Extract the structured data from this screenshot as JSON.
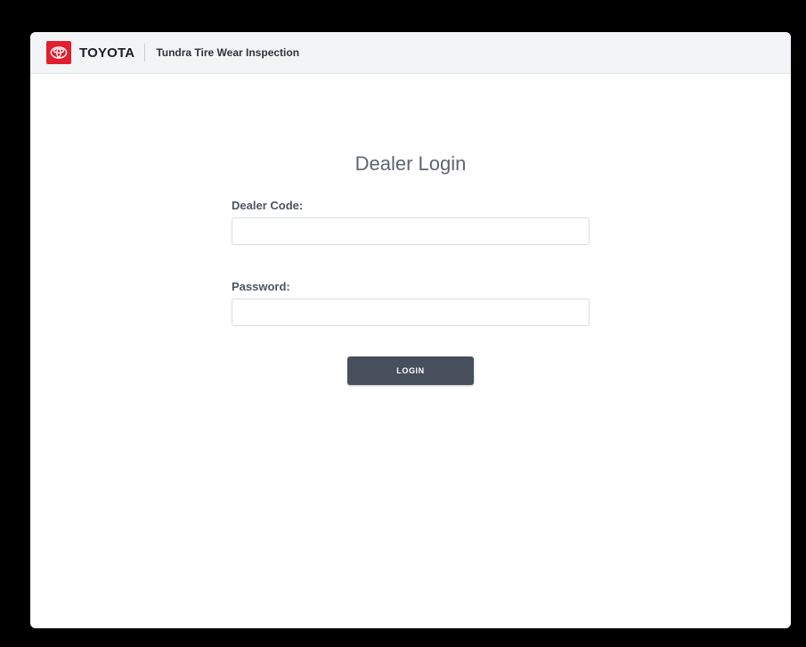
{
  "header": {
    "brand": "TOYOTA",
    "app_name": "Tundra Tire Wear Inspection",
    "logo_color": "#e0202e",
    "logo_icon": "toyota-logo-icon"
  },
  "login": {
    "title": "Dealer Login",
    "dealer_code_label": "Dealer Code:",
    "dealer_code_value": "",
    "password_label": "Password:",
    "password_value": "",
    "button_label": "LOGIN",
    "button_color": "#464f5b"
  }
}
